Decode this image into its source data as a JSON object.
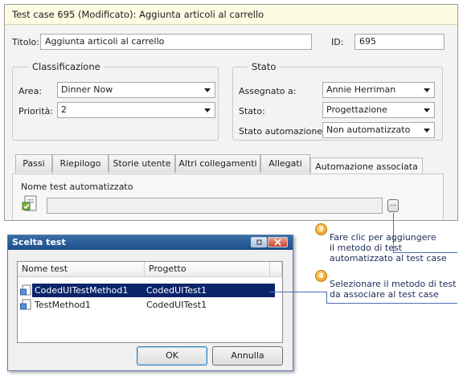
{
  "main_window": {
    "title": "Test case 695 (Modificato): Aggiunta articoli al carrello",
    "titolo_label": "Titolo:",
    "titolo_value": "Aggiunta articoli al carrello",
    "id_label": "ID:",
    "id_value": "695",
    "classificazione": {
      "legend": "Classificazione",
      "area_label": "Area:",
      "area_value": "Dinner Now",
      "priorita_label": "Priorità:",
      "priorita_value": "2"
    },
    "stato_group": {
      "legend": "Stato",
      "assegnato_label": "Assegnato a:",
      "assegnato_value": "Annie Herriman",
      "stato_label": "Stato:",
      "stato_value": "Progettazione",
      "automazione_label": "Stato automazione:",
      "automazione_value": "Non automatizzato"
    },
    "tabs": [
      {
        "label": "Passi"
      },
      {
        "label": "Riepilogo"
      },
      {
        "label": "Storie utente"
      },
      {
        "label": "Altri collegamenti"
      },
      {
        "label": "Allegati"
      },
      {
        "label": "Automazione associata",
        "active": true
      }
    ],
    "automation_panel": {
      "label": "Nome test automatizzato",
      "value": "",
      "browse_label": "..."
    }
  },
  "dialog": {
    "title": "Scelta test",
    "columns": [
      "Nome test",
      "Progetto"
    ],
    "rows": [
      {
        "name": "CodedUITestMethod1",
        "project": "CodedUITest1",
        "selected": true
      },
      {
        "name": "TestMethod1",
        "project": "CodedUITest1",
        "selected": false
      }
    ],
    "ok_label": "OK",
    "cancel_label": "Annulla"
  },
  "callouts": [
    {
      "number": "3",
      "text": [
        "Fare clic per aggiungere",
        "il metodo di test",
        "automatizzato al test case"
      ]
    },
    {
      "number": "4",
      "text": [
        "Selezionare il metodo di test",
        "da associare al test case"
      ]
    }
  ],
  "colors": {
    "accent": "#1c4e8a",
    "selection": "#0a246a",
    "title_bg": "#fdfbe2",
    "callout_badge": "#e89610"
  }
}
